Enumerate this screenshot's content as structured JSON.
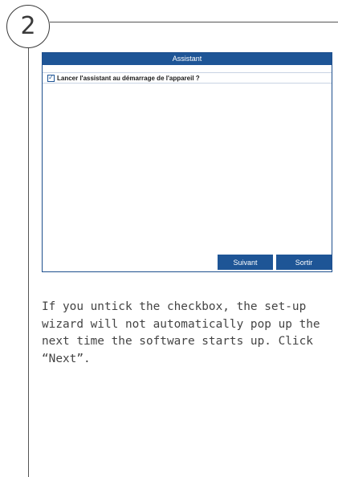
{
  "step": {
    "number": "2"
  },
  "dialog": {
    "title": "Assistant",
    "option": {
      "checked": true,
      "checkmark": "✓",
      "label": "Lancer l'assistant au démarrage de l'appareil ?"
    },
    "buttons": {
      "next_label": "Suivant",
      "exit_label": "Sortir"
    }
  },
  "instruction": {
    "text": "If you untick the checkbox, the set-up wizard will not automatically pop up the next time the software starts up. Click “Next”."
  },
  "colors": {
    "titlebar": "#1e5596",
    "button": "#1e5596",
    "text": "#444444",
    "rule": "#555555"
  }
}
